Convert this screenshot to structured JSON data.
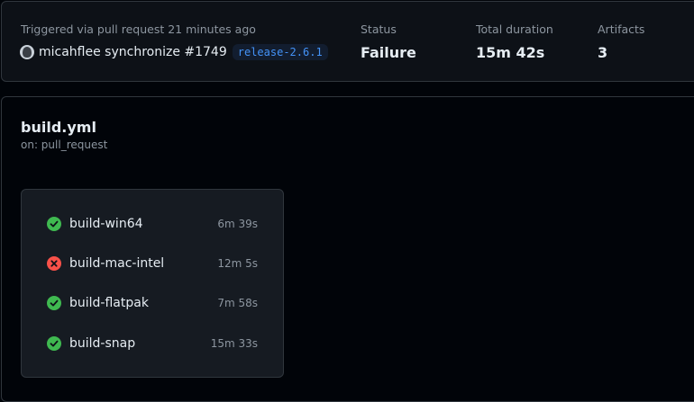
{
  "summary": {
    "trigger_text": "Triggered via pull request 21 minutes ago",
    "trigger_desc": "micahflee synchronize #1749",
    "branch": "release-2.6.1",
    "stats": [
      {
        "label": "Status",
        "value": "Failure"
      },
      {
        "label": "Total duration",
        "value": "15m 42s"
      },
      {
        "label": "Artifacts",
        "value": "3"
      }
    ]
  },
  "workflow": {
    "name": "build.yml",
    "trigger": "on: pull_request",
    "jobs": [
      {
        "name": "build-win64",
        "duration": "6m 39s",
        "status": "success"
      },
      {
        "name": "build-mac-intel",
        "duration": "12m 5s",
        "status": "failure"
      },
      {
        "name": "build-flatpak",
        "duration": "7m 58s",
        "status": "success"
      },
      {
        "name": "build-snap",
        "duration": "15m 33s",
        "status": "success"
      }
    ]
  },
  "colors": {
    "success": "#3fb950",
    "failure": "#f85149"
  }
}
